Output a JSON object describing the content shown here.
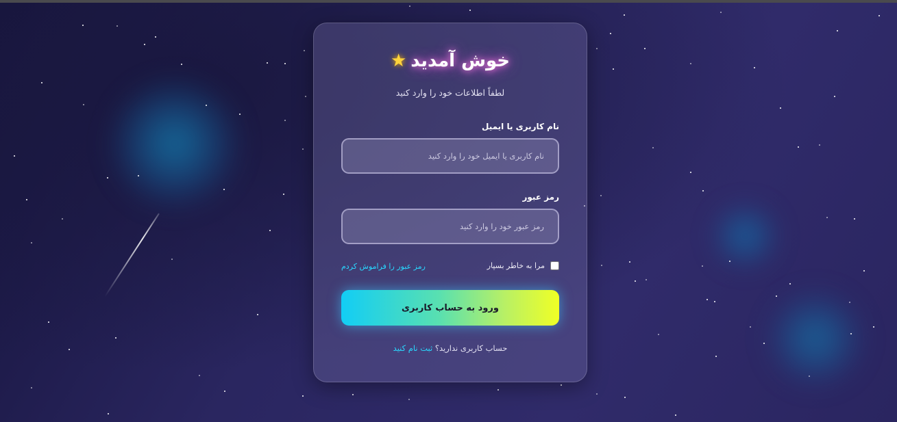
{
  "login": {
    "title": "خوش آمدید",
    "title_icon": "star-emoji",
    "subtitle": "لطفاً اطلاعات خود را وارد کنید",
    "username_label": "نام کاربری یا ایمیل",
    "username_placeholder": "نام کاربری یا ایمیل خود را وارد کنید",
    "username_value": "",
    "password_label": "رمز عبور",
    "password_placeholder": "رمز عبور خود را وارد کنید",
    "password_value": "",
    "remember_label": "مرا به خاطر بسپار",
    "remember_checked": false,
    "forgot_link": "رمز عبور را فراموش کردم",
    "submit_label": "ورود به حساب کاربری",
    "signup_prompt": "حساب کاربری ندارید؟",
    "signup_link": "ثبت نام کنید"
  },
  "colors": {
    "accent_link": "#29d8ff",
    "button_gradient_start": "#12cdf5",
    "button_gradient_end": "#f0ff25",
    "title_glow": "#ff7ee6"
  }
}
